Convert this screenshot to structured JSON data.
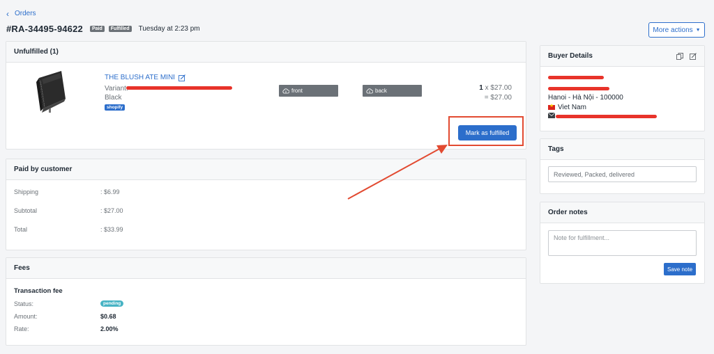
{
  "nav": {
    "back_label": "Orders"
  },
  "order": {
    "id": "#RA-34495-94622",
    "badges": [
      "Paid",
      "Fulfilled"
    ],
    "date": "Tuesday at 2:23 pm",
    "more_actions": "More actions"
  },
  "unfulfilled": {
    "title": "Unfulfilled (1)",
    "item": {
      "name": "THE BLUSH ATE MINI",
      "variant_label": "Variant:",
      "color": "Black",
      "source_badge": "shopify",
      "design_front": "front",
      "design_back": "back",
      "qty": "1",
      "unit_price": "x $27.00",
      "line_total": "= $27.00"
    },
    "fulfill_button": "Mark as fulfilled"
  },
  "paid": {
    "title": "Paid by customer",
    "rows": [
      {
        "label": "Shipping",
        "value": ": $6.99"
      },
      {
        "label": "Subtotal",
        "value": ": $27.00"
      },
      {
        "label": "Total",
        "value": ": $33.99"
      }
    ]
  },
  "fees": {
    "title": "Fees",
    "subtitle": "Transaction fee",
    "status_label": "Status:",
    "status_value": "pending",
    "amount_label": "Amount:",
    "amount_value": "$0.68",
    "rate_label": "Rate:",
    "rate_value": "2.00%"
  },
  "buyer": {
    "title": "Buyer Details",
    "city_line": "Hanoi - Hà Nội - 100000",
    "country": "Viet Nam"
  },
  "tags": {
    "title": "Tags",
    "value": "Reviewed, Packed, delivered"
  },
  "notes": {
    "title": "Order notes",
    "placeholder": "Note for fulfillment...",
    "save_button": "Save note"
  },
  "colors": {
    "accent": "#2c6ecb",
    "annotation": "#e24a31",
    "redaction": "#e8332a"
  }
}
